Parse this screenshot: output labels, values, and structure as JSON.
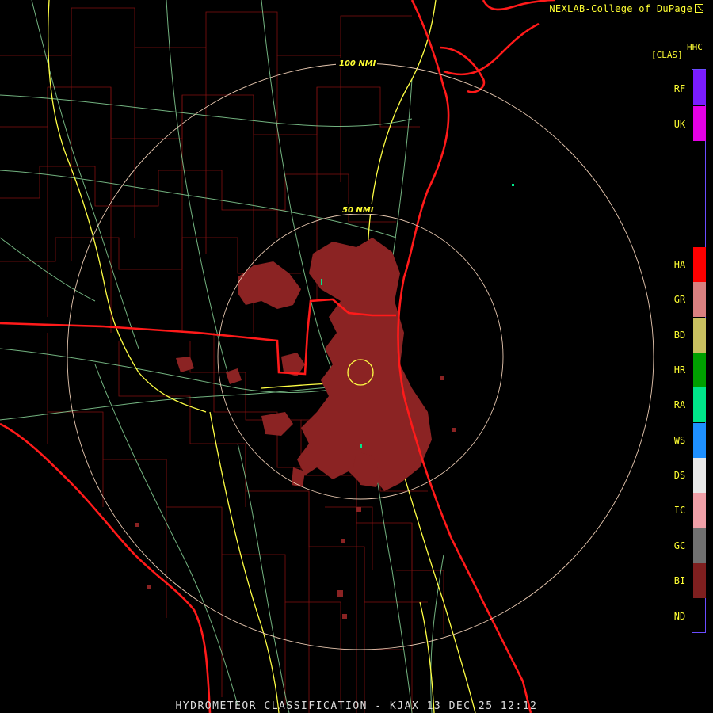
{
  "header": {
    "credit": "NEXLAB-College of DuPage",
    "product_code": "HHC",
    "product_class": "[CLAS]"
  },
  "footer": {
    "title": "HYDROMETEOR CLASSIFICATION - KJAX 13 DEC 25 12:12"
  },
  "range_rings": {
    "ring_100": "100 NMI",
    "ring_50": "50 NMI"
  },
  "legend": [
    {
      "code": "RF",
      "color": "#7b1cff"
    },
    {
      "code": "UK",
      "color": "#e600e6"
    },
    {
      "code": "HA",
      "color": "#ff0000"
    },
    {
      "code": "GR",
      "color": "#d98080"
    },
    {
      "code": "BD",
      "color": "#c8c060"
    },
    {
      "code": "HR",
      "color": "#00a000"
    },
    {
      "code": "RA",
      "color": "#00e68a"
    },
    {
      "code": "WS",
      "color": "#1e90ff"
    },
    {
      "code": "DS",
      "color": "#e8e8e8"
    },
    {
      "code": "IC",
      "color": "#f0a0a8"
    },
    {
      "code": "GC",
      "color": "#707070"
    },
    {
      "code": "BI",
      "color": "#7e1f1f"
    },
    {
      "code": "ND",
      "color": "#000000"
    }
  ],
  "colors": {
    "echo": "#8b2323",
    "boundary_state": "#ff1a1a",
    "county": "#a01818",
    "highway_interstate": "#ffff44",
    "highway_other": "#90e0a0",
    "range_ring": "#e8c8b0"
  },
  "icons": [
    "external-link-icon"
  ]
}
